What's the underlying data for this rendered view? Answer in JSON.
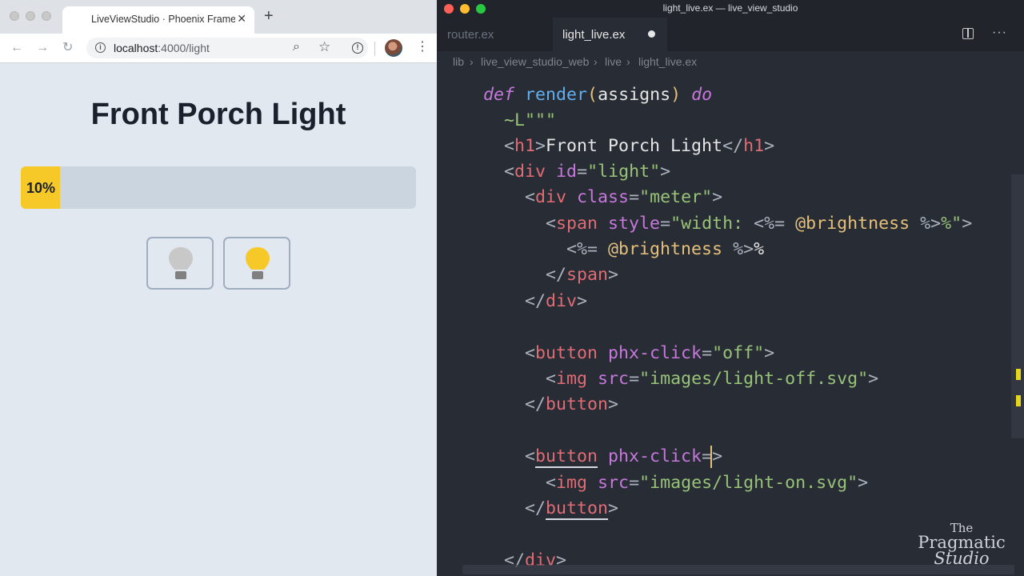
{
  "browser": {
    "tab_title": "LiveViewStudio · Phoenix Framework",
    "tab_close": "✕",
    "new_tab": "+",
    "url_host": "localhost",
    "url_path": ":4000/light",
    "nav_back": "←",
    "nav_forward": "→",
    "nav_reload": "↻",
    "menu": "⋮",
    "zoom": "⌕",
    "star": "☆",
    "ext": "!",
    "info": "i"
  },
  "page": {
    "heading": "Front Porch Light",
    "brightness_label": "10%",
    "brightness": 0.1
  },
  "editor": {
    "window_title": "light_live.ex — live_view_studio",
    "tabs": [
      {
        "label": "router.ex"
      },
      {
        "label": "light_live.ex"
      }
    ],
    "breadcrumb": [
      "lib",
      "live_view_studio_web",
      "live",
      "light_live.ex"
    ],
    "more": "···"
  },
  "code": {
    "l1_def": "def",
    "l1_fn": "render",
    "l1_open": "(",
    "l1_arg": "assigns",
    "l1_close": ")",
    "l1_do": "do",
    "l2": "~L\"\"\"",
    "l3_text": "Front Porch Light",
    "l4_id": "id",
    "l4_val": "\"light\"",
    "l5_class": "class",
    "l5_val": "\"meter\"",
    "l6_style": "style",
    "l6_val1": "\"width: ",
    "l6_expr_open": "<%=",
    "l6_expr": "@brightness",
    "l6_expr_close": "%>",
    "l6_val2": "%\"",
    "l7_open": "<%=",
    "l7_expr": "@brightness",
    "l7_close": "%>",
    "l7_pct": "%",
    "l10_attr": "phx-click",
    "l10_val": "\"off\"",
    "l11_attr": "src",
    "l11_val": "\"images/light-off.svg\"",
    "l14_attr": "phx-click",
    "l15_attr": "src",
    "l15_val": "\"images/light-on.svg\"",
    "tag_h1": "h1",
    "tag_div": "div",
    "tag_span": "span",
    "tag_button": "button",
    "tag_img": "img"
  },
  "watermark": {
    "the": "The",
    "pragmatic": "Pragmatic",
    "studio": "Studio"
  },
  "colors": {
    "meter_fill": "#f6c929",
    "bulb_on": "#f6c929",
    "bulb_off": "#c8c8c8"
  }
}
